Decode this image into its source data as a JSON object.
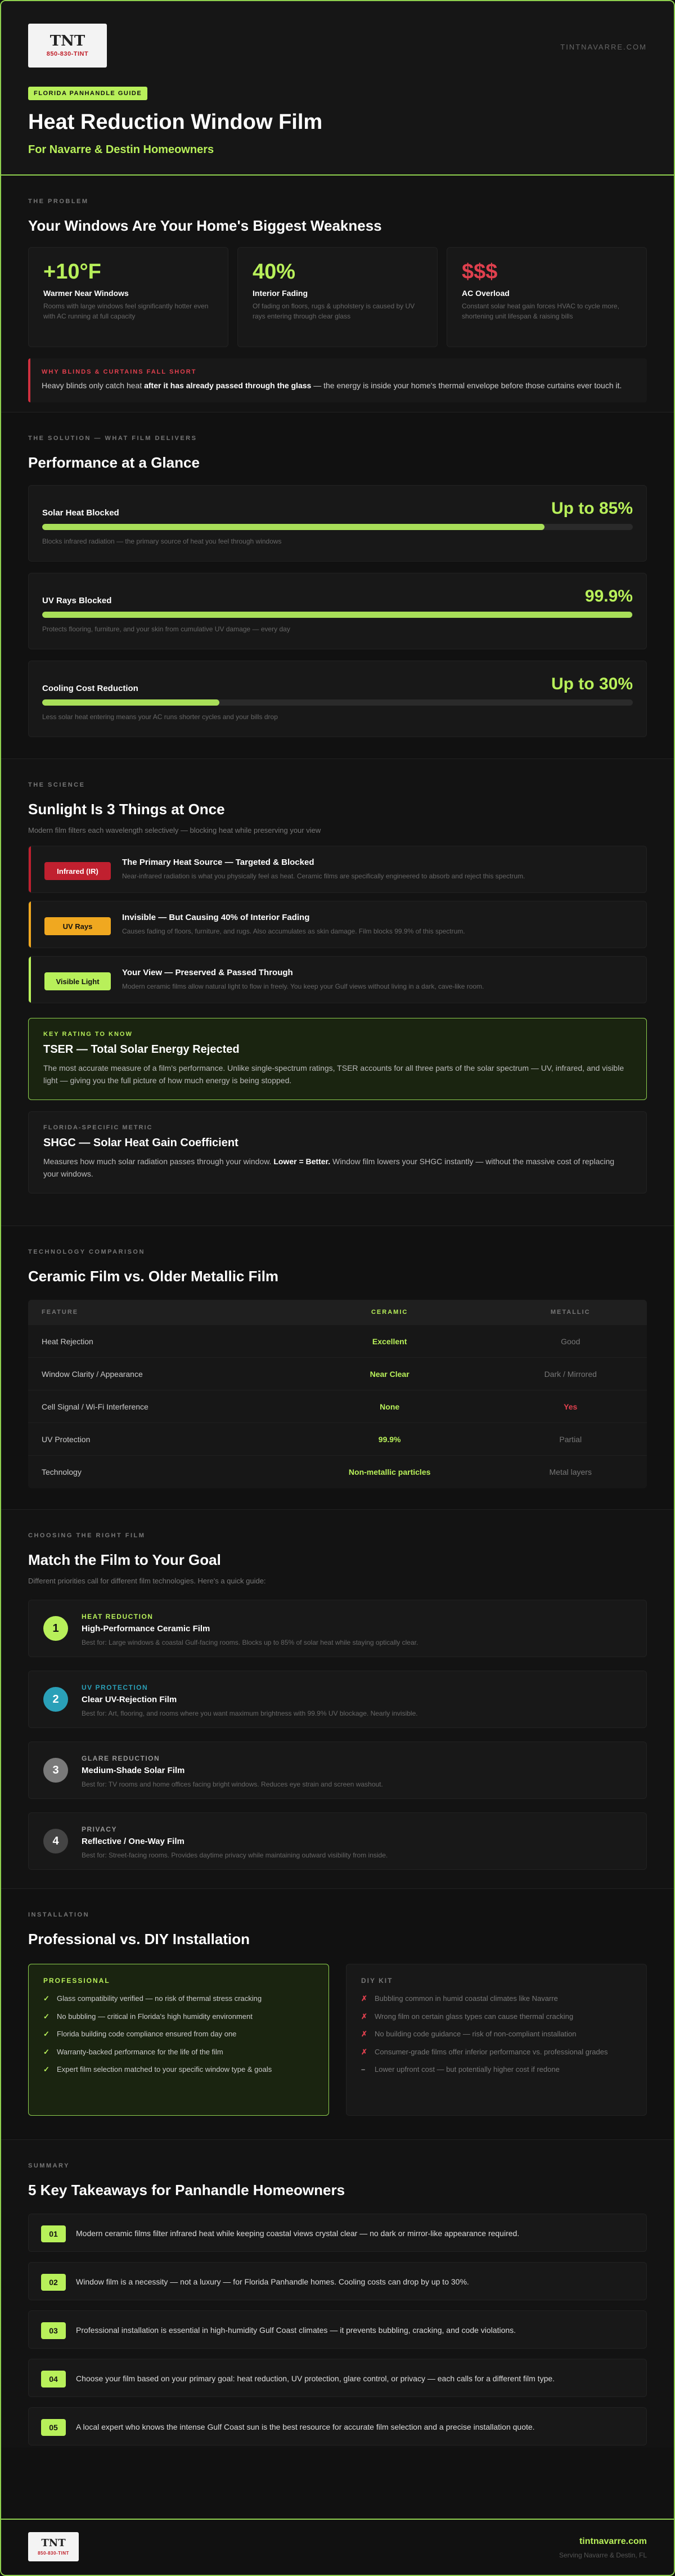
{
  "hero": {
    "logo_text": "TNT",
    "logo_phone": "850-830-TINT",
    "site": "TINTNAVARRE.COM",
    "pill": "FLORIDA PANHANDLE GUIDE",
    "title": "Heat Reduction Window Film",
    "subtitle": "For Navarre & Destin Homeowners"
  },
  "problem": {
    "eyebrow": "THE PROBLEM",
    "title": "Your Windows Are Your Home's Biggest Weakness",
    "stats": [
      {
        "num": "+10°F",
        "title": "Warmer Near Windows",
        "text": "Rooms with large windows feel significantly hotter even with AC running at full capacity",
        "color": "#b8f05a"
      },
      {
        "num": "40%",
        "title": "Interior Fading",
        "text": "Of fading on floors, rugs & upholstery is caused by UV rays entering through clear glass",
        "color": "#b8f05a"
      },
      {
        "num": "$$$",
        "title": "AC Overload",
        "text": "Constant solar heat gain forces HVAC to cycle more, shortening unit lifespan & raising bills",
        "color": "#e0404e"
      }
    ],
    "callout_label": "WHY BLINDS & CURTAINS FALL SHORT",
    "callout_text_1": "Heavy blinds only catch heat ",
    "callout_bold": "after it has already passed through the glass",
    "callout_text_2": " — the energy is inside your home's thermal envelope before those curtains ever touch it."
  },
  "solution": {
    "eyebrow": "THE SOLUTION — WHAT FILM DELIVERS",
    "title": "Performance at a Glance",
    "items": [
      {
        "title": "Solar Heat Blocked",
        "value": "Up to 85%",
        "fill": 0.85,
        "note": "Blocks infrared radiation — the primary source of heat you feel through windows"
      },
      {
        "title": "UV Rays Blocked",
        "value": "99.9%",
        "fill": 0.999,
        "note": "Protects flooring, furniture, and your skin from cumulative UV damage — every day"
      },
      {
        "title": "Cooling Cost Reduction",
        "value": "Up to 30%",
        "fill": 0.3,
        "note": "Less solar heat entering means your AC runs shorter cycles and your bills drop"
      }
    ]
  },
  "science": {
    "eyebrow": "THE SCIENCE",
    "title": "Sunlight Is 3 Things at Once",
    "desc": "Modern film filters each wavelength selectively — blocking heat while preserving your view",
    "rows": [
      {
        "tag": "Infrared (IR)",
        "tag_bg": "#c0202f",
        "tag_fg": "#ffffff",
        "accent": "#c0202f",
        "title": "The Primary Heat Source — Targeted & Blocked",
        "text": "Near-infrared radiation is what you physically feel as heat. Ceramic films are specifically engineered to absorb and reject this spectrum."
      },
      {
        "tag": "UV Rays",
        "tag_bg": "#f0a820",
        "tag_fg": "#111111",
        "accent": "#f0a820",
        "title": "Invisible — But Causing 40% of Interior Fading",
        "text": "Causes fading of floors, furniture, and rugs. Also accumulates as skin damage. Film blocks 99.9% of this spectrum."
      },
      {
        "tag": "Visible Light",
        "tag_bg": "#b8f05a",
        "tag_fg": "#111111",
        "accent": "#b8f05a",
        "title": "Your View — Preserved & Passed Through",
        "text": "Modern ceramic films allow natural light to flow in freely. You keep your Gulf views without living in a dark, cave-like room."
      }
    ],
    "tser": {
      "k": "KEY RATING TO KNOW",
      "t": "TSER — Total Solar Energy Rejected",
      "b": "The most accurate measure of a film's performance. Unlike single-spectrum ratings, TSER accounts for all three parts of the solar spectrum — UV, infrared, and visible light — giving you the full picture of how much energy is being stopped."
    },
    "shgc": {
      "k": "FLORIDA-SPECIFIC METRIC",
      "t": "SHGC — Solar Heat Gain Coefficient",
      "b1": "Measures how much solar radiation passes through your window. ",
      "bold": "Lower = Better.",
      "b2": " Window film lowers your SHGC instantly — without the massive cost of replacing your windows."
    }
  },
  "comparison": {
    "eyebrow": "TECHNOLOGY COMPARISON",
    "title": "Ceramic Film vs. Older Metallic Film",
    "headers": [
      "FEATURE",
      "CERAMIC",
      "METALLIC"
    ],
    "rows": [
      {
        "feature": "Heat Rejection",
        "ceramic": "Excellent",
        "metallic": "Good",
        "mcolor": "#777777"
      },
      {
        "feature": "Window Clarity / Appearance",
        "ceramic": "Near Clear",
        "metallic": "Dark / Mirrored",
        "mcolor": "#777777"
      },
      {
        "feature": "Cell Signal / Wi-Fi Interference",
        "ceramic": "None",
        "metallic": "Yes",
        "mcolor": "#e0404e"
      },
      {
        "feature": "UV Protection",
        "ceramic": "99.9%",
        "metallic": "Partial",
        "mcolor": "#777777"
      },
      {
        "feature": "Technology",
        "ceramic": "Non-metallic particles",
        "metallic": "Metal layers",
        "mcolor": "#777777"
      }
    ]
  },
  "goals": {
    "eyebrow": "CHOOSING THE RIGHT FILM",
    "title": "Match the Film to Your Goal",
    "desc": "Different priorities call for different film technologies. Here's a quick guide:",
    "items": [
      {
        "n": "1",
        "color": "#b8f05a",
        "k": "HEAT REDUCTION",
        "t": "High-Performance Ceramic Film",
        "d": "Best for: Large windows & coastal Gulf-facing rooms. Blocks up to 85% of solar heat while staying optically clear."
      },
      {
        "n": "2",
        "color": "#2aa0b8",
        "k": "UV PROTECTION",
        "t": "Clear UV-Rejection Film",
        "d": "Best for: Art, flooring, and rooms where you want maximum brightness with 99.9% UV blockage. Nearly invisible."
      },
      {
        "n": "3",
        "color": "#7a7a7a",
        "k": "GLARE REDUCTION",
        "t": "Medium-Shade Solar Film",
        "d": "Best for: TV rooms and home offices facing bright windows. Reduces eye strain and screen washout."
      },
      {
        "n": "4",
        "color": "#444444",
        "k": "PRIVACY",
        "t": "Reflective / One-Way Film",
        "d": "Best for: Street-facing rooms. Provides daytime privacy while maintaining outward visibility from inside."
      }
    ]
  },
  "install": {
    "eyebrow": "INSTALLATION",
    "title": "Professional vs. DIY Installation",
    "pro_label": "PROFESSIONAL",
    "pro": [
      "Glass compatibility verified — no risk of thermal stress cracking",
      "No bubbling — critical in Florida's high humidity environment",
      "Florida building code compliance ensured from day one",
      "Warranty-backed performance for the life of the film",
      "Expert film selection matched to your specific window type & goals"
    ],
    "diy_label": "DIY KIT",
    "diy": [
      {
        "mark": "✗",
        "text": "Bubbling common in humid coastal climates like Navarre"
      },
      {
        "mark": "✗",
        "text": "Wrong film on certain glass types can cause thermal cracking"
      },
      {
        "mark": "✗",
        "text": "No building code guidance — risk of non-compliant installation"
      },
      {
        "mark": "✗",
        "text": "Consumer-grade films offer inferior performance vs. professional grades"
      },
      {
        "mark": "–",
        "text": "Lower upfront cost — but potentially higher cost if redone"
      }
    ]
  },
  "summary": {
    "eyebrow": "SUMMARY",
    "title": "5 Key Takeaways for Panhandle Homeowners",
    "items": [
      {
        "n": "01",
        "t": "Modern ceramic films filter infrared heat while keeping coastal views crystal clear — no dark or mirror-like appearance required."
      },
      {
        "n": "02",
        "t": "Window film is a necessity — not a luxury — for Florida Panhandle homes. Cooling costs can drop by up to 30%."
      },
      {
        "n": "03",
        "t": "Professional installation is essential in high-humidity Gulf Coast climates — it prevents bubbling, cracking, and code violations."
      },
      {
        "n": "04",
        "t": "Choose your film based on your primary goal: heat reduction, UV protection, glare control, or privacy — each calls for a different film type."
      },
      {
        "n": "05",
        "t": "A local expert who knows the intense Gulf Coast sun is the best resource for accurate film selection and a precise installation quote."
      }
    ]
  },
  "footer": {
    "url": "tintnavarre.com",
    "serving": "Serving Navarre & Destin, FL"
  }
}
